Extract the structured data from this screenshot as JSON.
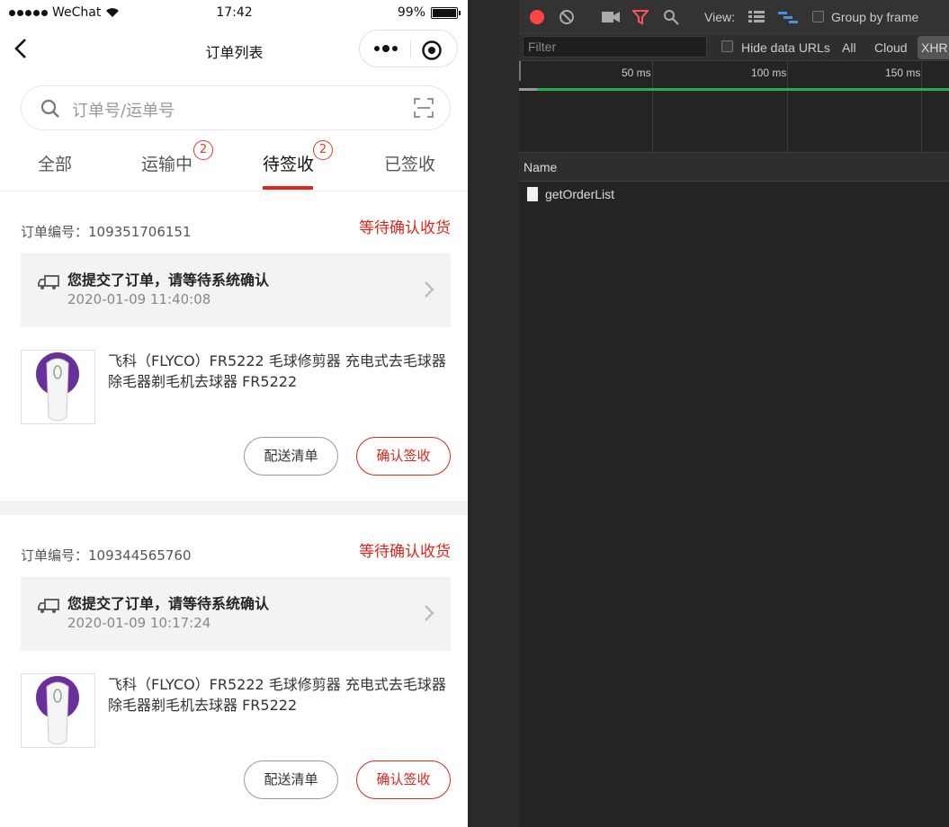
{
  "status_bar": {
    "carrier": "WeChat",
    "time": "17:42",
    "battery": "99%",
    "battery_level": 0.99
  },
  "nav": {
    "title": "订单列表"
  },
  "search": {
    "placeholder": "订单号/运单号"
  },
  "tabs": [
    {
      "label": "全部",
      "badge": ""
    },
    {
      "label": "运输中",
      "badge": "2"
    },
    {
      "label": "待签收",
      "badge": "2",
      "active": true
    },
    {
      "label": "已签收",
      "badge": ""
    }
  ],
  "orders": [
    {
      "order_no": "订单编号：109351706151",
      "status": "等待确认收货",
      "track_message": "您提交了订单，请等待系统确认",
      "track_time": "2020-01-09 11:40:08",
      "product_name": "飞科（FLYCO）FR5222 毛球修剪器 充电式去毛球器除毛器剃毛机去球器 FR5222",
      "btn_delivery": "配送清单",
      "btn_confirm": "确认签收"
    },
    {
      "order_no": "订单编号：109344565760",
      "status": "等待确认收货",
      "track_message": "您提交了订单，请等待系统确认",
      "track_time": "2020-01-09 10:17:24",
      "product_name": "飞科（FLYCO）FR5222 毛球修剪器 充电式去毛球器除毛器剃毛机去球器 FR5222",
      "btn_delivery": "配送清单",
      "btn_confirm": "确认签收"
    }
  ],
  "devtools": {
    "view_label": "View:",
    "group_by_frame": "Group by frame",
    "filter_placeholder": "Filter",
    "hide_data_urls": "Hide data URLs",
    "all": "All",
    "cloud": "Cloud",
    "xhr": "XHR",
    "timeline_labels": [
      "50 ms",
      "100 ms",
      "150 ms"
    ],
    "name_header": "Name",
    "requests": [
      "getOrderList"
    ],
    "colors": {
      "record": "#ff4444",
      "timeline_bar": "#22b14c"
    }
  },
  "accent_color": "#e0251b"
}
